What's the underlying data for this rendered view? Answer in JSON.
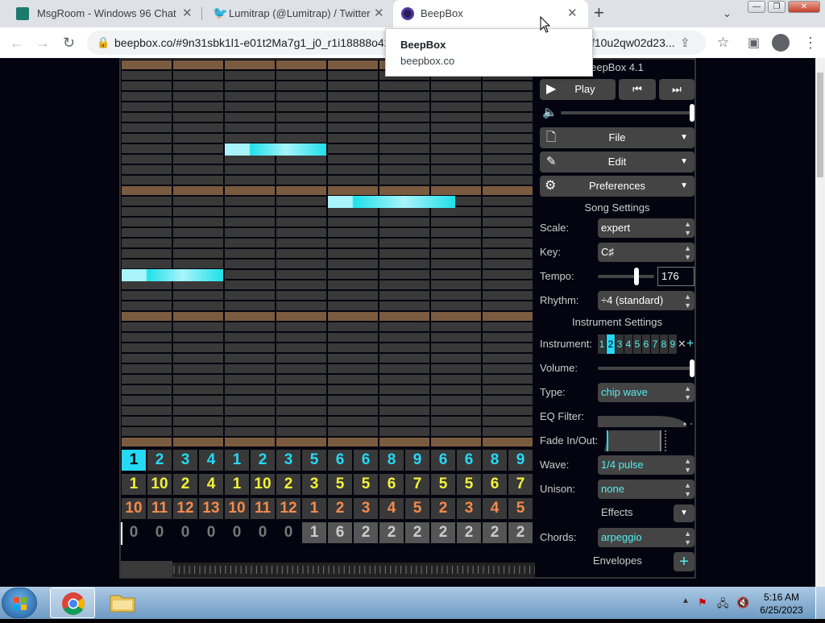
{
  "browser": {
    "tabs": [
      {
        "title": "MsgRoom - Windows 96 Chat",
        "icon": "msgroom-icon"
      },
      {
        "title": "Lumitrap (@Lumitrap) / Twitter",
        "icon": "twitter-icon"
      },
      {
        "title": "BeepBox",
        "icon": "beepbox-icon",
        "active": true
      }
    ],
    "url": "beepbox.co/#9n31sbk1l1-e01t2Ma7g1_j0_r1i18888o42",
    "url_tail": "f10u2qw02d23...",
    "popup": {
      "title": "BeepBox",
      "subtitle": "beepbox.co"
    },
    "window_controls": [
      "minimize",
      "restore",
      "close"
    ]
  },
  "beepbox": {
    "version": "eepBox 4.1",
    "play_label": "Play",
    "menus": [
      {
        "label": "File",
        "icon": "file-icon"
      },
      {
        "label": "Edit",
        "icon": "pencil-icon"
      },
      {
        "label": "Preferences",
        "icon": "gear-icon"
      }
    ],
    "song_settings": {
      "heading": "Song Settings",
      "scale_label": "Scale:",
      "scale": "expert",
      "key_label": "Key:",
      "key": "C♯",
      "tempo_label": "Tempo:",
      "tempo": "176",
      "tempo_slider_level": 0.7,
      "rhythm_label": "Rhythm:",
      "rhythm": "÷4 (standard)"
    },
    "instrument_settings": {
      "heading": "Instrument Settings",
      "instrument_label": "Instrument:",
      "instruments": [
        "1",
        "2",
        "3",
        "4",
        "5",
        "6",
        "7",
        "8",
        "9"
      ],
      "selected_instrument": "2",
      "volume_label": "Volume:",
      "volume_level": 1.0,
      "type_label": "Type:",
      "type": "chip wave",
      "eq_label": "EQ Filter:",
      "fade_label": "Fade In/Out:",
      "wave_label": "Wave:",
      "wave": "1/4 pulse",
      "unison_label": "Unison:",
      "unison": "none",
      "effects_label": "Effects",
      "chords_label": "Chords:",
      "chords": "arpeggio",
      "envelopes_label": "Envelopes"
    },
    "pattern_rows": [
      [
        "1",
        "2",
        "3",
        "4",
        "1",
        "2",
        "3",
        "5",
        "6",
        "6",
        "8",
        "9",
        "6",
        "6",
        "8",
        "9"
      ],
      [
        "1",
        "10",
        "2",
        "4",
        "1",
        "10",
        "2",
        "3",
        "5",
        "5",
        "6",
        "7",
        "5",
        "5",
        "6",
        "7"
      ],
      [
        "10",
        "11",
        "12",
        "13",
        "10",
        "11",
        "12",
        "1",
        "2",
        "3",
        "4",
        "5",
        "2",
        "3",
        "4",
        "5"
      ],
      [
        "0",
        "0",
        "0",
        "0",
        "0",
        "0",
        "0",
        "1",
        "6",
        "2",
        "2",
        "2",
        "2",
        "2",
        "2",
        "2"
      ]
    ],
    "row_colors": [
      "#25d9f5",
      "#f3f33a",
      "#f58a4d",
      "#bbbbbb"
    ],
    "note_color": "#20e0e8"
  },
  "taskbar": {
    "time": "5:16 AM",
    "date": "6/25/2023"
  }
}
